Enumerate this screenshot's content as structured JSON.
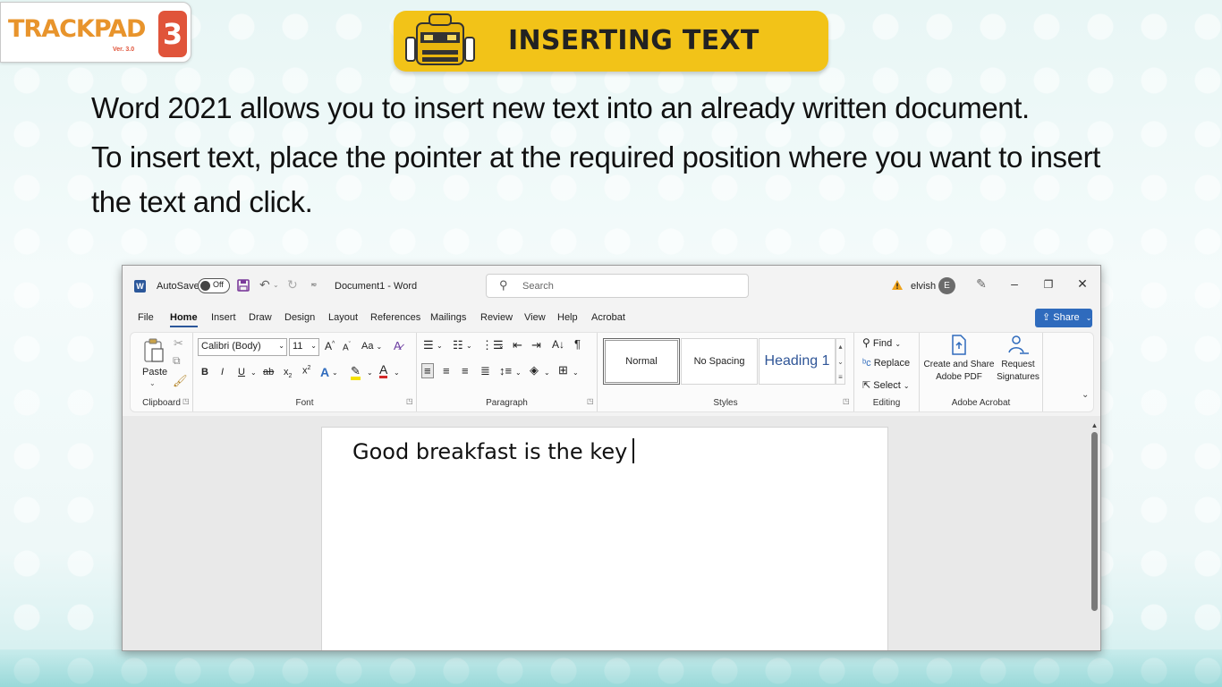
{
  "logo": {
    "text": "TRACKPAD",
    "number": "3",
    "version": "Ver. 3.0"
  },
  "banner": {
    "title": "INSERTING TEXT"
  },
  "paragraphs": [
    "Word 2021 allows you to insert new text into an already written document.",
    "To insert text, place the pointer at the required position where you want to insert",
    "the text and click."
  ],
  "word": {
    "autosave_label": "AutoSave",
    "autosave_state": "Off",
    "doc_title": "Document1  -  Word",
    "search_placeholder": "Search",
    "user_name": "elvish",
    "user_initial": "E",
    "menu": [
      "File",
      "Home",
      "Insert",
      "Draw",
      "Design",
      "Layout",
      "References",
      "Mailings",
      "Review",
      "View",
      "Help",
      "Acrobat"
    ],
    "share_label": "Share",
    "ribbon": {
      "clipboard": {
        "paste": "Paste",
        "label": "Clipboard"
      },
      "font": {
        "family": "Calibri (Body)",
        "size": "11",
        "case": "Aa",
        "label": "Font"
      },
      "paragraph": {
        "label": "Paragraph"
      },
      "styles": {
        "normal": "Normal",
        "no_spacing": "No Spacing",
        "heading1": "Heading 1",
        "label": "Styles"
      },
      "editing": {
        "find": "Find",
        "replace": "Replace",
        "select": "Select",
        "label": "Editing"
      },
      "acrobat": {
        "create_line1": "Create and Share",
        "create_line2": "Adobe PDF",
        "request_line1": "Request",
        "request_line2": "Signatures",
        "label": "Adobe Acrobat"
      }
    },
    "document_text": "Good breakfast is the key"
  },
  "colors": {
    "banner": "#f2c318",
    "word_blue": "#2b579a",
    "share_blue": "#2f6bbd",
    "logo_orange": "#e8942c",
    "logo_red": "#e0543a"
  }
}
